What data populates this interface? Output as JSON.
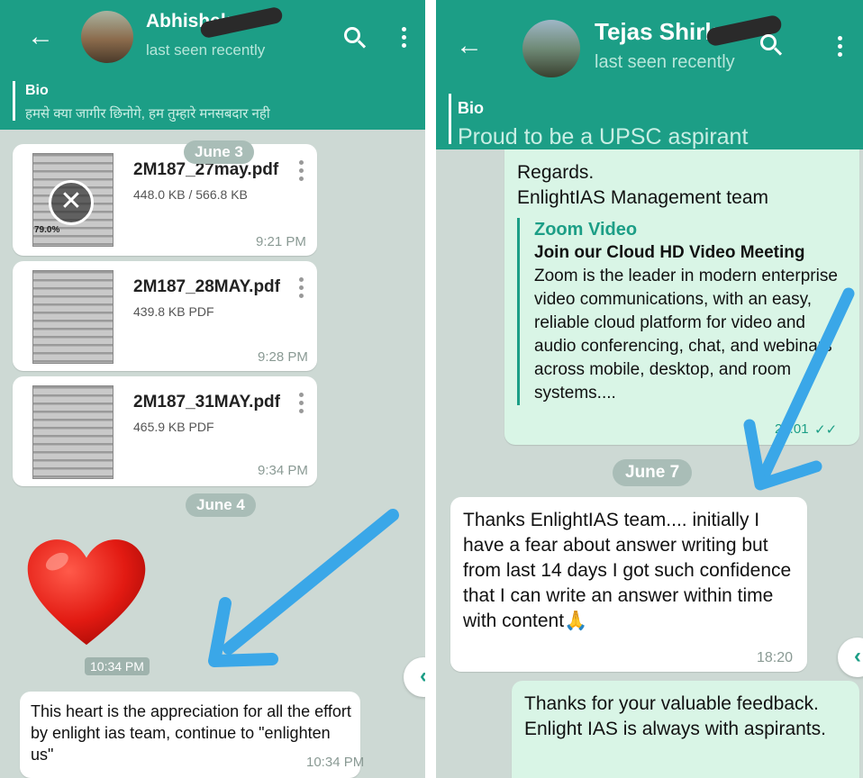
{
  "left_chat": {
    "header": {
      "back_icon": "arrow-left-icon",
      "contact_name": "Abhishek",
      "last_seen": "last seen recently"
    },
    "bio": {
      "label": "Bio",
      "text": "हमसे क्या जागीर छिनोगे, हम तुम्हारे मनसबदार नही"
    },
    "date_separators": [
      "June 3",
      "June 4"
    ],
    "files": [
      {
        "name": "2M187_27may.pdf",
        "meta": "448.0 KB / 566.8 KB",
        "progress_label": "79.0%",
        "progress": 0.79,
        "time": "9:21 PM"
      },
      {
        "name": "2M187_28MAY.pdf",
        "meta": "439.8 KB PDF",
        "time": "9:28 PM"
      },
      {
        "name": "2M187_31MAY.pdf",
        "meta": "465.9 KB PDF",
        "time": "9:34 PM"
      }
    ],
    "sticker": {
      "icon": "red-heart-icon",
      "time": "10:34 PM"
    },
    "last_message": {
      "text": "This heart is the appreciation for all the effort by enlight ias team, continue to \"enlighten us\"",
      "time": "10:34 PM"
    }
  },
  "right_chat": {
    "header": {
      "back_icon": "arrow-left-icon",
      "contact_name": "Tejas Shirke",
      "last_seen": "last seen recently"
    },
    "bio": {
      "label": "Bio",
      "text": "Proud to be a UPSC aspirant"
    },
    "outgoing_top": {
      "text_lines": [
        "Regards.",
        "EnlightIAS Management team"
      ],
      "preview_site": "Zoom Video",
      "preview_title": "Join our Cloud HD Video Meeting",
      "preview_desc": "Zoom is the leader in modern enterprise video communications, with an easy, reliable cloud platform for video and audio conferencing, chat, and webinars across mobile, desktop, and room systems....",
      "time": "23:01"
    },
    "date_separator": "June 7",
    "incoming": {
      "text": "Thanks EnlightIAS team.... initially I  have a fear about answer writing but from last 14 days I got such confidence that I can write an answer within time with content🙏",
      "time": "18:20"
    },
    "outgoing_bottom": {
      "text": "Thanks for your valuable feedback. Enlight IAS is always with aspirants."
    }
  },
  "colors": {
    "header": "#1c9e86",
    "chat_bg": "#cdd9d4",
    "outgoing_bubble": "#d9f5e6",
    "arrow": "#3aa7e8"
  }
}
